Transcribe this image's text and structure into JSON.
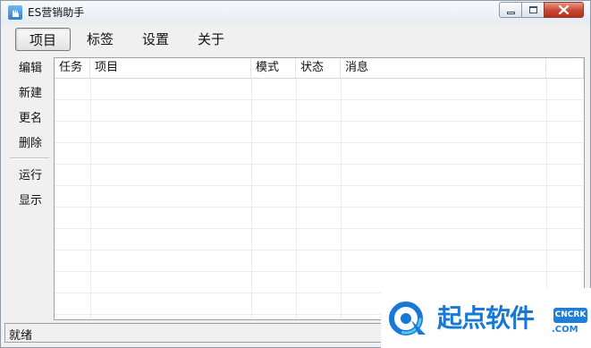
{
  "window": {
    "title": "ES营销助手"
  },
  "menu": {
    "items": [
      "项目",
      "标签",
      "设置",
      "关于"
    ]
  },
  "sidebar": {
    "items_top": [
      "编辑",
      "新建",
      "更名",
      "删除"
    ],
    "items_bottom": [
      "运行",
      "显示"
    ]
  },
  "table": {
    "columns": [
      "任务",
      "项目",
      "模式",
      "状态",
      "消息",
      ""
    ]
  },
  "status": {
    "text": "就绪"
  },
  "watermark": {
    "text": "起点软件",
    "badge": "CNCRK",
    "domain": ".COM"
  },
  "colors": {
    "accent": "#1778d6",
    "close_button": "#c9462f"
  },
  "icons": {
    "app": "app-icon",
    "minimize": "minimize-icon",
    "maximize": "maximize-icon",
    "close": "close-icon",
    "logo": "qidian-logo-icon"
  }
}
